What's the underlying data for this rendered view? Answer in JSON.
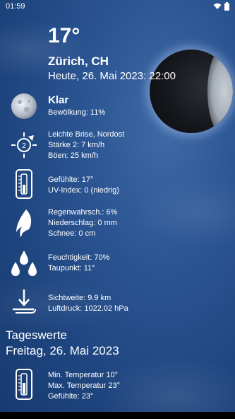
{
  "status": {
    "time": "01:59"
  },
  "current": {
    "temperature": "17°",
    "location": "Zürich, CH",
    "date": "Heute, 26. Mai 2023: 22:00"
  },
  "conditions": {
    "label": "Klar",
    "cloud_cover": "Bewölkung: 11%"
  },
  "wind": {
    "line1": "Leichte Brise, Nordost",
    "line2": "Stärke 2: 7 km/h",
    "line3": "Böen: 25 km/h",
    "badge": "2"
  },
  "feel": {
    "line1": "Gefühlte: 17°",
    "line2": "UV-Index: 0 (niedrig)"
  },
  "precip": {
    "line1": "Regenwahrsch.: 6%",
    "line2": "Niederschlag: 0 mm",
    "line3": "Schnee: 0 cm"
  },
  "humidity": {
    "line1": "Feuchtigkeit: 70%",
    "line2": "Taupunkt: 11°"
  },
  "visibility": {
    "line1": "Sichtweite: 9.9 km",
    "line2": "Luftdruck: 1022.02 hPa"
  },
  "daily": {
    "title": "Tageswerte",
    "date": "Freitag, 26. Mai 2023",
    "line1": "Min. Temperatur 10°",
    "line2": "Max. Temperatur 23°",
    "line3": "Gefühlte: 23°"
  }
}
